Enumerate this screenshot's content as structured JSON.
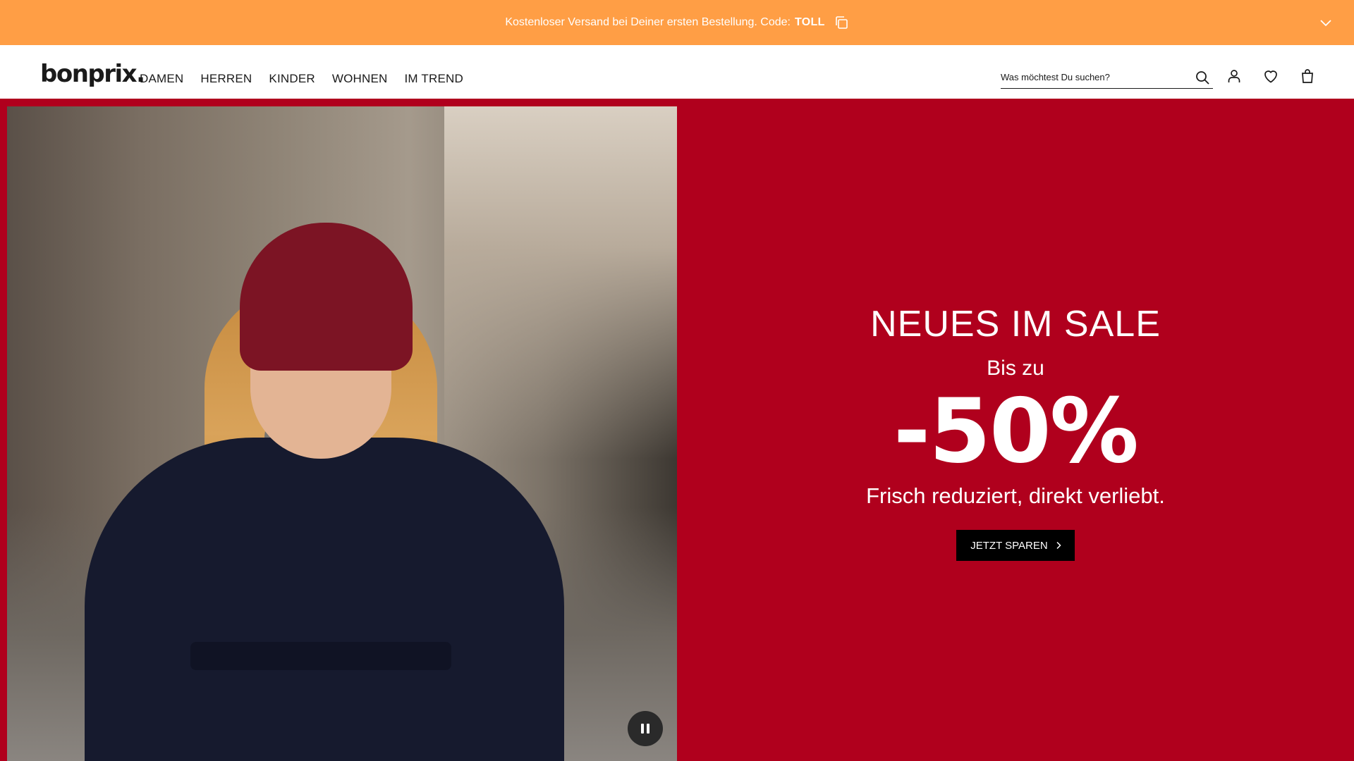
{
  "promo": {
    "text": "Kostenloser Versand bei Deiner ersten Bestellung. Code:",
    "code": "TOLL",
    "icons": {
      "copy": "copy-icon",
      "collapse": "chevron-down-icon"
    }
  },
  "header": {
    "logo": "bonprix.",
    "nav": [
      "DAMEN",
      "HERREN",
      "KINDER",
      "WOHNEN",
      "IM TREND"
    ],
    "search_placeholder": "Was möchtest Du suchen?",
    "icons": [
      "search-icon",
      "account-icon",
      "heart-icon",
      "shopping-bag-icon"
    ]
  },
  "hero": {
    "title": "NEUES IM SALE",
    "subtitle": "Bis zu",
    "discount": "-50%",
    "tagline": "Frisch reduziert, direkt verliebt.",
    "cta_label": "JETZT SPAREN",
    "pause_icon": "pause-icon"
  },
  "colors": {
    "promo_bg": "#ff9e45",
    "hero_bg": "#b0001d",
    "cta_bg": "#000000",
    "text_light": "#ffffff",
    "text_dark": "#1a1a1a"
  }
}
